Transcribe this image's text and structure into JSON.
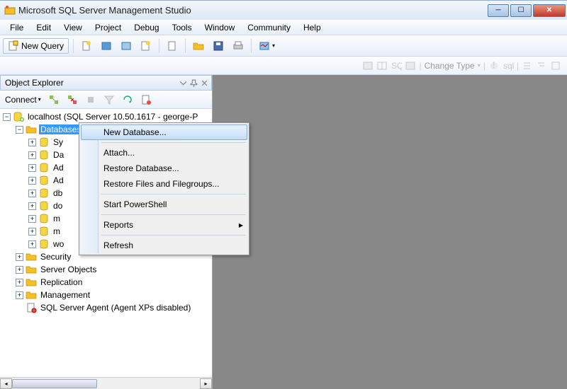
{
  "title": "Microsoft SQL Server Management Studio",
  "menubar": [
    "File",
    "Edit",
    "View",
    "Project",
    "Debug",
    "Tools",
    "Window",
    "Community",
    "Help"
  ],
  "toolbar": {
    "new_query": "New Query"
  },
  "sec_toolbar": {
    "change_type": "Change Type"
  },
  "object_explorer": {
    "title": "Object Explorer",
    "connect": "Connect",
    "root": "localhost (SQL Server 10.50.1617 - george-P",
    "databases_label": "Databases",
    "db_children": [
      "Sy",
      "Da",
      "Ad",
      "Ad",
      "db",
      "do",
      "m",
      "m",
      "wo"
    ],
    "top_nodes": [
      "Security",
      "Server Objects",
      "Replication",
      "Management"
    ],
    "agent": "SQL Server Agent (Agent XPs disabled)"
  },
  "context_menu": {
    "items": [
      {
        "label": "New Database...",
        "hov": true
      },
      {
        "sep": true
      },
      {
        "label": "Attach..."
      },
      {
        "label": "Restore Database..."
      },
      {
        "label": "Restore Files and Filegroups..."
      },
      {
        "sep": true
      },
      {
        "label": "Start PowerShell"
      },
      {
        "sep": true
      },
      {
        "label": "Reports",
        "arrow": true
      },
      {
        "sep": true
      },
      {
        "label": "Refresh"
      }
    ]
  }
}
